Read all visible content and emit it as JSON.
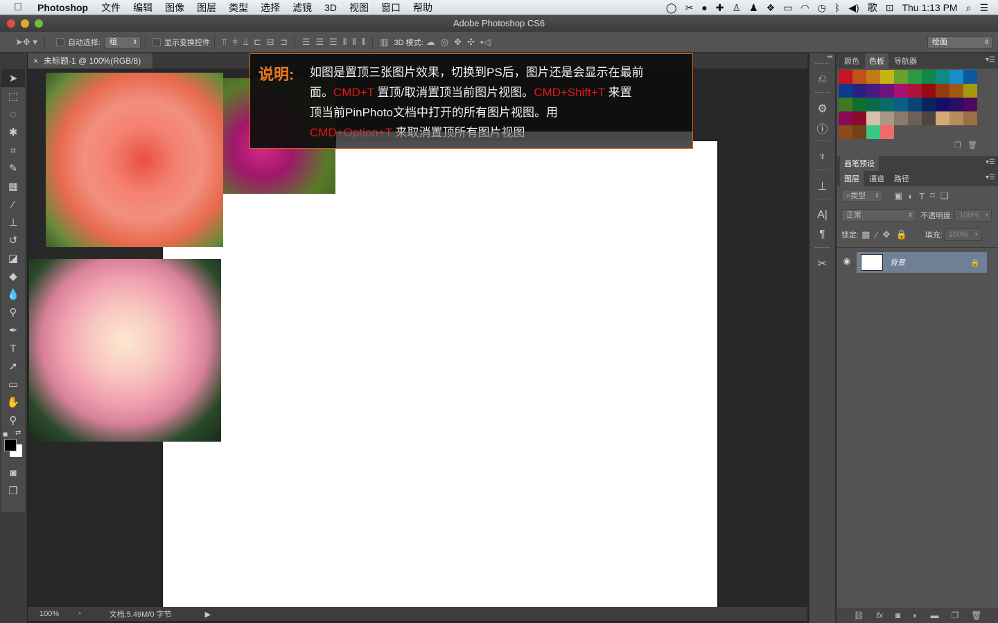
{
  "menubar": {
    "apple": "",
    "app_name": "Photoshop",
    "items": [
      "文件",
      "编辑",
      "图像",
      "图层",
      "类型",
      "选择",
      "滤镜",
      "3D",
      "视图",
      "窗口",
      "帮助"
    ],
    "status_icons": [
      "scroll-icon",
      "scissors-icon",
      "record-icon",
      "plus-icon",
      "pinphoto-icon",
      "qq-icon",
      "dropbox-icon",
      "battery-icon",
      "wifi-icon",
      "time-machine-icon",
      "bluetooth-icon",
      "volume-icon",
      "input-method-icon",
      "display-icon"
    ],
    "clock": "Thu 1:13 PM"
  },
  "window": {
    "title": "Adobe Photoshop CS6"
  },
  "options": {
    "auto_select_label": "自动选择:",
    "auto_select_value": "组",
    "show_transform_label": "显示变换控件",
    "mode_3d_label": "3D 模式:",
    "workspace": "绘画"
  },
  "document": {
    "tab_label": "未标题-1 @ 100%(RGB/8)"
  },
  "notice": {
    "label": "说明:",
    "line1": "如图是置顶三张图片效果，切换到PS后，图片还是会显示在最前",
    "line2_pre": "面。",
    "shortcut1": "CMD+T",
    "line2_mid": " 置顶/取消置顶当前图片视图。",
    "shortcut2": "CMD+Shift+T",
    "line2_post": " 来置",
    "line3": "顶当前PinPhoto文档中打开的所有图片视图。用",
    "shortcut3": "CMD+Option+T",
    "line4": " 来取消置顶所有图片视图"
  },
  "status": {
    "zoom": "100%",
    "doc_info": "文档:5.49M/0 字节"
  },
  "panels": {
    "swatch_tabs": [
      "颜色",
      "色板",
      "导航器"
    ],
    "swatch_active": "色板",
    "swatches": [
      "#c8141e",
      "#c2501a",
      "#c27a14",
      "#c4b414",
      "#6aa02c",
      "#2a9a44",
      "#10884a",
      "#0e8a88",
      "#1a8cc8",
      "#0a5aa0",
      "#0c3c8c",
      "#2a2080",
      "#4a1a84",
      "#6c1480",
      "#aa1070",
      "#b0103c",
      "#960c10",
      "#983a10",
      "#9c5c10",
      "#a49810",
      "#3e7a20",
      "#0e6e30",
      "#0a6a48",
      "#0a6c66",
      "#0a5e8c",
      "#0a4478",
      "#0a2460",
      "#14106a",
      "#2c0e64",
      "#4c0a5e",
      "#8a0a56",
      "#8e0a2c",
      "#d6c0a8",
      "#a89888",
      "#8a7a6c",
      "#6e6058",
      "#4e4442",
      "#d4a878",
      "#b88c5c",
      "#9c7044",
      "#8a4a1c",
      "#74401a",
      "#3ac882",
      "#f06a6a"
    ],
    "brush_preset_tab": "画笔预设",
    "layer_tabs": [
      "图层",
      "通道",
      "路径"
    ],
    "layer_active": "图层",
    "filter_kind": "类型",
    "blend_mode": "正常",
    "opacity_label": "不透明度:",
    "opacity_value": "100%",
    "lock_label": "锁定:",
    "fill_label": "填充:",
    "fill_value": "100%",
    "layers": [
      {
        "name": "背景",
        "visible": true,
        "locked": true
      }
    ]
  },
  "colors": {
    "accent_orange": "#f07a1e",
    "shortcut_red": "#e81414",
    "layer_selected": "#6f7f96"
  }
}
